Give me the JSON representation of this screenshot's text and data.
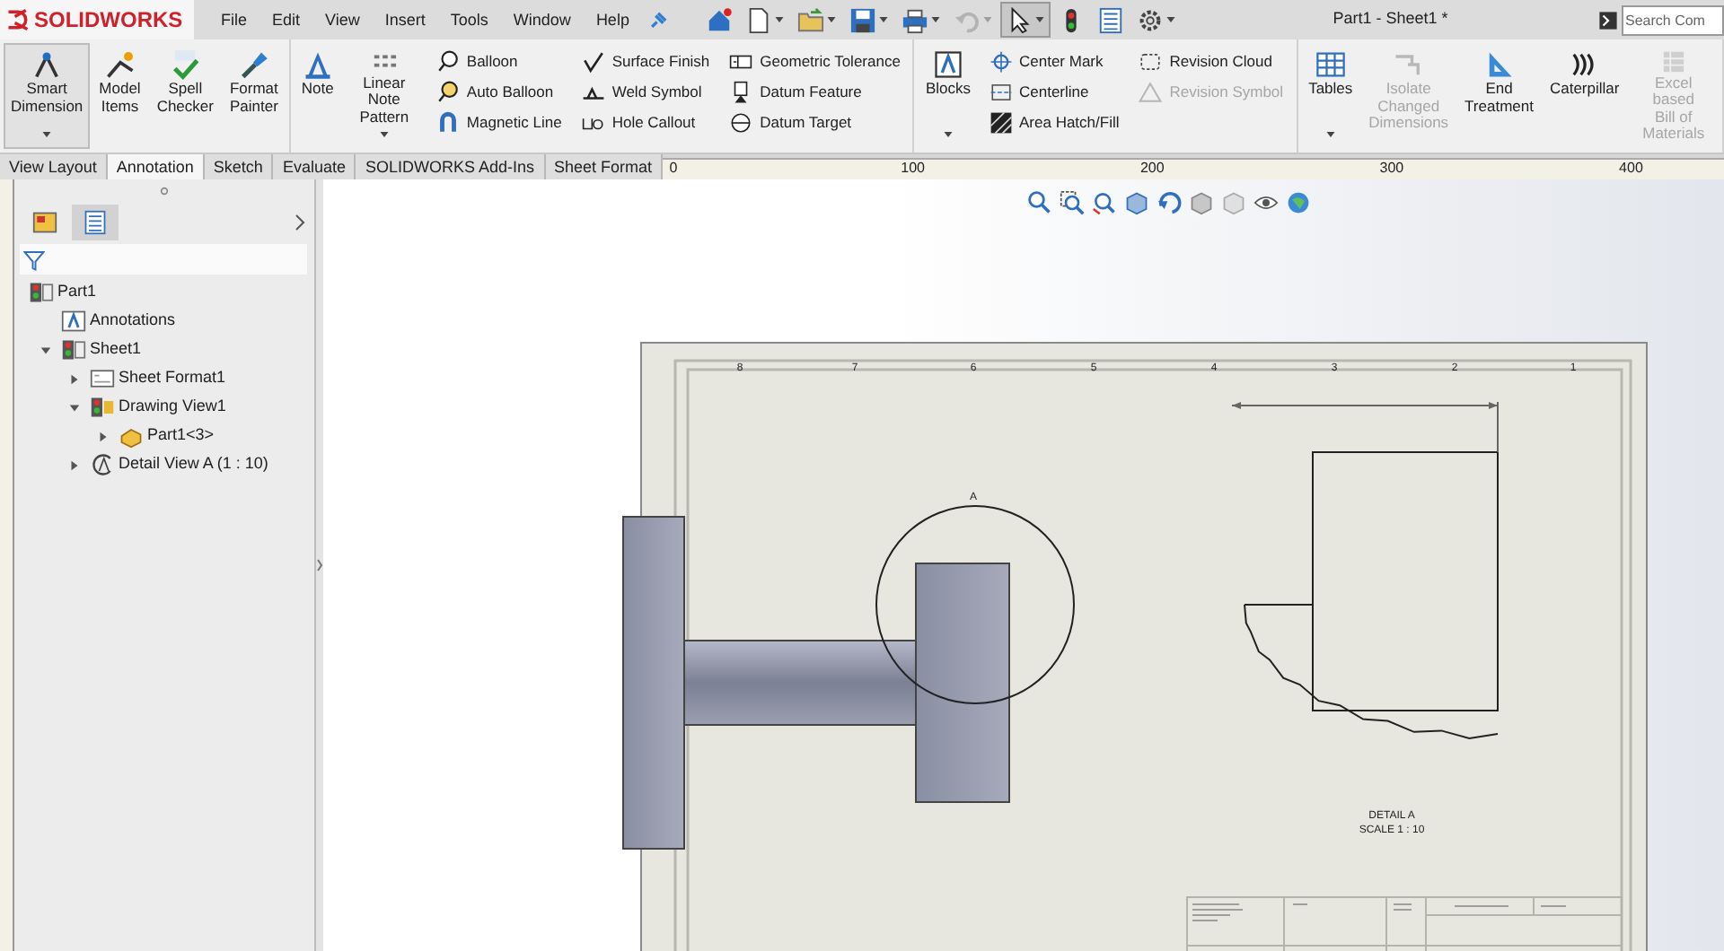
{
  "app": {
    "logo": "SOLIDWORKS",
    "menu": [
      "File",
      "Edit",
      "View",
      "Insert",
      "Tools",
      "Window",
      "Help"
    ],
    "quick_access": [
      {
        "dropdown": false,
        "disabled": false,
        "selected": false
      },
      {
        "dropdown": true,
        "disabled": false,
        "selected": false
      },
      {
        "dropdown": true,
        "disabled": false,
        "selected": false
      },
      {
        "dropdown": true,
        "disabled": false,
        "selected": false
      },
      {
        "dropdown": true,
        "disabled": false,
        "selected": false
      },
      {
        "dropdown": true,
        "disabled": true,
        "selected": false
      },
      {
        "dropdown": true,
        "disabled": false,
        "selected": true
      },
      {
        "dropdown": false,
        "disabled": false,
        "selected": false
      },
      {
        "dropdown": false,
        "disabled": false,
        "selected": false
      },
      {
        "dropdown": true,
        "disabled": false,
        "selected": false
      }
    ],
    "title": "Part1 - Sheet1 *",
    "search": {
      "placeholder": "Search Com"
    }
  },
  "ribbon": {
    "sections": [
      [
        {
          "kind": "large",
          "label": "Smart\nDimension",
          "selected": true,
          "disabled": false,
          "dropdown": true
        },
        {
          "kind": "large",
          "label": "Model\nItems",
          "selected": false,
          "disabled": false,
          "dropdown": false
        },
        {
          "kind": "large",
          "label": "Spell\nChecker",
          "selected": false,
          "disabled": false,
          "dropdown": false
        },
        {
          "kind": "large",
          "label": "Format\nPainter",
          "selected": false,
          "disabled": false,
          "dropdown": false
        }
      ],
      [
        {
          "kind": "large",
          "label": "Note",
          "selected": false,
          "disabled": false,
          "dropdown": false
        },
        {
          "kind": "large",
          "label": "Linear Note\nPattern",
          "selected": false,
          "disabled": false,
          "dropdown": true
        },
        {
          "kind": "stack",
          "items": [
            {
              "label": "Balloon",
              "disabled": false
            },
            {
              "label": "Auto Balloon",
              "disabled": false
            },
            {
              "label": "Magnetic Line",
              "disabled": false
            }
          ]
        },
        {
          "kind": "stack",
          "items": [
            {
              "label": "Surface Finish",
              "disabled": false
            },
            {
              "label": "Weld Symbol",
              "disabled": false
            },
            {
              "label": "Hole Callout",
              "disabled": false
            }
          ]
        },
        {
          "kind": "stack",
          "items": [
            {
              "label": "Geometric Tolerance",
              "disabled": false
            },
            {
              "label": "Datum Feature",
              "disabled": false
            },
            {
              "label": "Datum Target",
              "disabled": false
            }
          ]
        }
      ],
      [
        {
          "kind": "large",
          "label": "Blocks",
          "selected": false,
          "disabled": false,
          "dropdown": true
        },
        {
          "kind": "stack",
          "items": [
            {
              "label": "Center Mark",
              "disabled": false
            },
            {
              "label": "Centerline",
              "disabled": false
            },
            {
              "label": "Area Hatch/Fill",
              "disabled": false
            }
          ]
        },
        {
          "kind": "stack",
          "items": [
            {
              "label": "Revision Cloud",
              "disabled": false
            },
            {
              "label": "Revision Symbol",
              "disabled": true
            }
          ]
        }
      ],
      [
        {
          "kind": "large",
          "label": "Tables",
          "selected": false,
          "disabled": false,
          "dropdown": true
        },
        {
          "kind": "large",
          "label": "Isolate\nChanged\nDimensions",
          "selected": false,
          "disabled": true,
          "dropdown": false
        },
        {
          "kind": "large",
          "label": "End\nTreatment",
          "selected": false,
          "disabled": false,
          "dropdown": false
        },
        {
          "kind": "large",
          "label": "Caterpillar",
          "selected": false,
          "disabled": false,
          "dropdown": false
        },
        {
          "kind": "large",
          "label": "Excel based\nBill of\nMaterials",
          "selected": false,
          "disabled": true,
          "dropdown": false
        }
      ]
    ]
  },
  "tabs": [
    {
      "label": "View Layout",
      "selected": false
    },
    {
      "label": "Annotation",
      "selected": true
    },
    {
      "label": "Sketch",
      "selected": false
    },
    {
      "label": "Evaluate",
      "selected": false
    },
    {
      "label": "SOLIDWORKS Add-Ins",
      "selected": false
    },
    {
      "label": "Sheet Format",
      "selected": false
    }
  ],
  "ruler": {
    "labels": [
      "0",
      "100",
      "200",
      "300",
      "400"
    ]
  },
  "feature_tree": {
    "panel_tabs": [
      {
        "selected": false
      },
      {
        "selected": true
      }
    ],
    "items": [
      {
        "label": "Part1",
        "kind": "root",
        "children": [
          {
            "label": "Annotations",
            "kind": "leaf"
          },
          {
            "label": "Sheet1",
            "kind": "branch",
            "expanded": true,
            "children": [
              {
                "label": "Sheet Format1",
                "kind": "branch",
                "expanded": false
              },
              {
                "label": "Drawing View1",
                "kind": "branch",
                "expanded": true,
                "children": [
                  {
                    "label": "Part1<3>",
                    "kind": "branch",
                    "expanded": false
                  }
                ]
              },
              {
                "label": "Detail View A (1 : 10)",
                "kind": "branch",
                "expanded": false
              }
            ]
          }
        ]
      }
    ]
  },
  "sheet": {
    "zones": [
      "8",
      "7",
      "6",
      "5",
      "4",
      "3",
      "2",
      "1"
    ],
    "detail_callout": "A",
    "detail_caption": "DETAIL A",
    "detail_scale": "SCALE 1 : 10"
  }
}
